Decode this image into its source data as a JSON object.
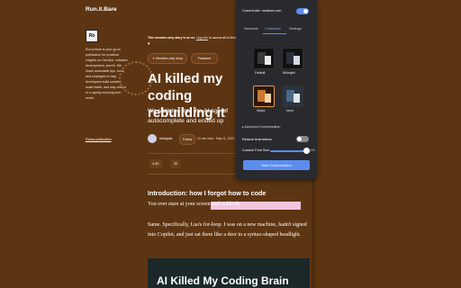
{
  "site": {
    "brand": "Run.it.Bare",
    "logo_text": "Rb",
    "description": "Run.it.Bare is your go-to publication for practical insights on DevOps, software development, and AI. We share actionable tips, tools, and strategies to help developers build smarter, scale faster, and stay ahead in a rapidly evolving tech world.",
    "follow_publication": "Follow publication"
  },
  "article": {
    "member_note_bold": "This member-only story is on us.",
    "member_note_link": "Upgrade",
    "member_note_rest": "to access all of Medium.",
    "badge_member": "Member-only story",
    "badge_featured": "Featured",
    "title": "AI killed my coding rebuilding it",
    "subtitle": "We sprinted into the AI age of autocomplete and ended up wondering why we forgot how to write code",
    "author": "rdxbyjule",
    "follow": "Follow",
    "read_time": "10 min read",
    "date": "May 11, 2025",
    "claps": "4.4K",
    "comments": "39",
    "section_heading": "Introduction: how I forgot how to code",
    "para1": "You ever stare at your screen and suddenly",
    "para2": "Same. Specifically, Lua's for-loop. I was on a new machine, hadn't signed into Copilot, and just sat there like a deer in a syntax-shaped headlight.",
    "hero_text": "AI Killed My Coding Brain"
  },
  "popup": {
    "current_site": "Current site: medium.com",
    "tabs": [
      "Schedule",
      "Customize",
      "Settings"
    ],
    "active_tab": 1,
    "themes": [
      "Default",
      "Midnight",
      "Sepia",
      "Nord"
    ],
    "selected_theme": "Sepia",
    "advanced": "▸ Advanced Customization",
    "reduce_animations": "Reduce Animations",
    "reduce_animations_on": false,
    "enabled_on": true,
    "font_size_label": "Custom Font Size",
    "font_size_value": "100",
    "save_label": "Save Customization"
  },
  "colors": {
    "background": "#5e3512",
    "accent": "#5b8def",
    "popup_bg": "#2a2a2e",
    "highlight": "#f4c6de"
  }
}
